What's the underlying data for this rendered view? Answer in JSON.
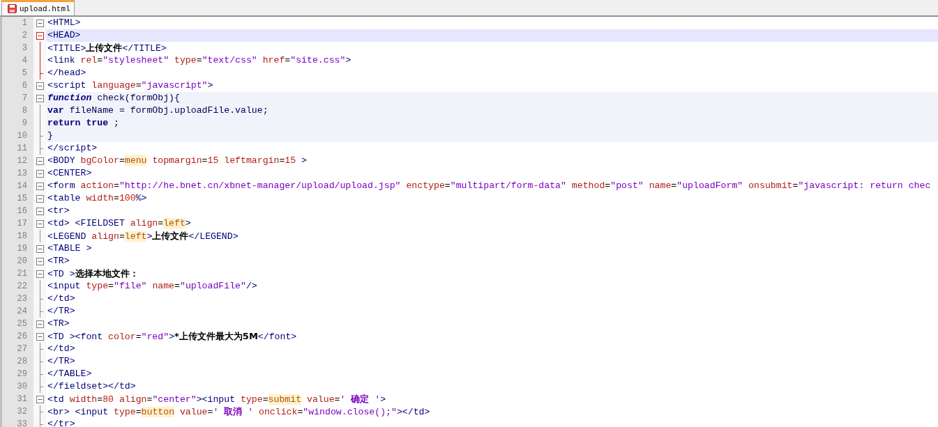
{
  "tab": {
    "label": "upload.html",
    "selected": true
  },
  "lines": [
    {
      "number": "1",
      "kind": "fold-start",
      "fold_active": false,
      "current": false,
      "in_block": false,
      "tokens": [
        {
          "kind": "tag",
          "text": "<HTML>"
        }
      ]
    },
    {
      "number": "2",
      "kind": "fold-start",
      "fold_active": true,
      "current": true,
      "in_block": false,
      "tokens": [
        {
          "kind": "tag",
          "text": "<HEAD>"
        }
      ]
    },
    {
      "number": "3",
      "kind": "fold-body",
      "fold_active": true,
      "current": false,
      "in_block": false,
      "tokens": [
        {
          "kind": "tag",
          "text": "<TITLE>"
        },
        {
          "kind": "text",
          "text": "上传文件"
        },
        {
          "kind": "tag",
          "text": "</TITLE>"
        }
      ]
    },
    {
      "number": "4",
      "kind": "fold-body",
      "fold_active": true,
      "current": false,
      "in_block": false,
      "tokens": [
        {
          "kind": "tag",
          "text": "<link"
        },
        {
          "kind": "attr",
          "text": " rel"
        },
        {
          "kind": "op",
          "text": "="
        },
        {
          "kind": "val",
          "text": "\"stylesheet\""
        },
        {
          "kind": "attr",
          "text": " type"
        },
        {
          "kind": "op",
          "text": "="
        },
        {
          "kind": "val",
          "text": "\"text/css\""
        },
        {
          "kind": "attr",
          "text": " href"
        },
        {
          "kind": "op",
          "text": "="
        },
        {
          "kind": "val",
          "text": "\"site.css\""
        },
        {
          "kind": "tag",
          "text": ">"
        }
      ]
    },
    {
      "number": "5",
      "kind": "fold-end",
      "fold_active": true,
      "current": false,
      "in_block": false,
      "tokens": [
        {
          "kind": "tag",
          "text": "</head>"
        }
      ]
    },
    {
      "number": "6",
      "kind": "fold-start",
      "fold_active": false,
      "current": false,
      "in_block": false,
      "tokens": [
        {
          "kind": "tag",
          "text": "<script"
        },
        {
          "kind": "attr",
          "text": " language"
        },
        {
          "kind": "op",
          "text": "="
        },
        {
          "kind": "val",
          "text": "\"javascript\""
        },
        {
          "kind": "tag",
          "text": ">"
        }
      ]
    },
    {
      "number": "7",
      "kind": "fold-start",
      "fold_active": false,
      "current": false,
      "in_block": true,
      "tokens": [
        {
          "kind": "keyword-italic",
          "text": "function"
        },
        {
          "kind": "js",
          "text": " check(formObj){"
        }
      ]
    },
    {
      "number": "8",
      "kind": "fold-body",
      "fold_active": false,
      "current": false,
      "in_block": true,
      "tokens": [
        {
          "kind": "keyword",
          "text": "var"
        },
        {
          "kind": "js",
          "text": " fileName = formObj.uploadFile.value;"
        }
      ]
    },
    {
      "number": "9",
      "kind": "fold-body",
      "fold_active": false,
      "current": false,
      "in_block": true,
      "tokens": [
        {
          "kind": "keyword",
          "text": "return true"
        },
        {
          "kind": "js",
          "text": " ;"
        }
      ]
    },
    {
      "number": "10",
      "kind": "fold-end",
      "fold_active": false,
      "current": false,
      "in_block": true,
      "tokens": [
        {
          "kind": "js",
          "text": "}"
        }
      ]
    },
    {
      "number": "11",
      "kind": "fold-end",
      "fold_active": false,
      "current": false,
      "in_block": false,
      "tokens": [
        {
          "kind": "tag",
          "text": "</script>"
        }
      ]
    },
    {
      "number": "12",
      "kind": "fold-start",
      "fold_active": false,
      "current": false,
      "in_block": false,
      "tokens": [
        {
          "kind": "tag",
          "text": "<BODY"
        },
        {
          "kind": "attr",
          "text": " bgColor"
        },
        {
          "kind": "op",
          "text": "="
        },
        {
          "kind": "bare",
          "text": "menu"
        },
        {
          "kind": "attr",
          "text": " topmargin"
        },
        {
          "kind": "op",
          "text": "="
        },
        {
          "kind": "num",
          "text": "15"
        },
        {
          "kind": "attr",
          "text": " leftmargin"
        },
        {
          "kind": "op",
          "text": "="
        },
        {
          "kind": "num",
          "text": "15"
        },
        {
          "kind": "tag",
          "text": " >"
        }
      ]
    },
    {
      "number": "13",
      "kind": "fold-start",
      "fold_active": false,
      "current": false,
      "in_block": false,
      "tokens": [
        {
          "kind": "tag",
          "text": "<CENTER>"
        }
      ]
    },
    {
      "number": "14",
      "kind": "fold-start",
      "fold_active": false,
      "current": false,
      "in_block": false,
      "tokens": [
        {
          "kind": "tag",
          "text": "<form"
        },
        {
          "kind": "attr",
          "text": " action"
        },
        {
          "kind": "op",
          "text": "="
        },
        {
          "kind": "val",
          "text": "\"http://he.bnet.cn/xbnet-manager/upload/upload.jsp\""
        },
        {
          "kind": "attr",
          "text": " enctype"
        },
        {
          "kind": "op",
          "text": "="
        },
        {
          "kind": "val",
          "text": "\"multipart/form-data\""
        },
        {
          "kind": "attr",
          "text": " method"
        },
        {
          "kind": "op",
          "text": "="
        },
        {
          "kind": "val",
          "text": "\"post\""
        },
        {
          "kind": "attr",
          "text": " name"
        },
        {
          "kind": "op",
          "text": "="
        },
        {
          "kind": "val",
          "text": "\"uploadForm\""
        },
        {
          "kind": "attr",
          "text": " onsubmit"
        },
        {
          "kind": "op",
          "text": "="
        },
        {
          "kind": "val",
          "text": "\"javascript: return chec"
        }
      ]
    },
    {
      "number": "15",
      "kind": "fold-start",
      "fold_active": false,
      "current": false,
      "in_block": false,
      "tokens": [
        {
          "kind": "tag",
          "text": "<table"
        },
        {
          "kind": "attr",
          "text": " width"
        },
        {
          "kind": "op",
          "text": "="
        },
        {
          "kind": "num",
          "text": "100"
        },
        {
          "kind": "tag",
          "text": "%>"
        }
      ]
    },
    {
      "number": "16",
      "kind": "fold-start",
      "fold_active": false,
      "current": false,
      "in_block": false,
      "tokens": [
        {
          "kind": "tag",
          "text": "<tr>"
        }
      ]
    },
    {
      "number": "17",
      "kind": "fold-start",
      "fold_active": false,
      "current": false,
      "in_block": false,
      "tokens": [
        {
          "kind": "tag",
          "text": "<td> <FIELDSET"
        },
        {
          "kind": "attr",
          "text": " align"
        },
        {
          "kind": "op",
          "text": "="
        },
        {
          "kind": "bare",
          "text": "left"
        },
        {
          "kind": "tag",
          "text": ">"
        }
      ]
    },
    {
      "number": "18",
      "kind": "fold-body",
      "fold_active": false,
      "current": false,
      "in_block": false,
      "tokens": [
        {
          "kind": "tag",
          "text": "<LEGEND"
        },
        {
          "kind": "attr",
          "text": " align"
        },
        {
          "kind": "op",
          "text": "="
        },
        {
          "kind": "bare",
          "text": "left"
        },
        {
          "kind": "tag",
          "text": ">"
        },
        {
          "kind": "text",
          "text": "上传文件"
        },
        {
          "kind": "tag",
          "text": "</LEGEND>"
        }
      ]
    },
    {
      "number": "19",
      "kind": "fold-start",
      "fold_active": false,
      "current": false,
      "in_block": false,
      "tokens": [
        {
          "kind": "tag",
          "text": "<TABLE >"
        }
      ]
    },
    {
      "number": "20",
      "kind": "fold-start",
      "fold_active": false,
      "current": false,
      "in_block": false,
      "tokens": [
        {
          "kind": "tag",
          "text": "<TR>"
        }
      ]
    },
    {
      "number": "21",
      "kind": "fold-start",
      "fold_active": false,
      "current": false,
      "in_block": false,
      "tokens": [
        {
          "kind": "tag",
          "text": "<TD >"
        },
        {
          "kind": "text",
          "text": "选择本地文件："
        }
      ]
    },
    {
      "number": "22",
      "kind": "fold-body",
      "fold_active": false,
      "current": false,
      "in_block": false,
      "tokens": [
        {
          "kind": "tag",
          "text": "<input"
        },
        {
          "kind": "attr",
          "text": " type"
        },
        {
          "kind": "op",
          "text": "="
        },
        {
          "kind": "val",
          "text": "\"file\""
        },
        {
          "kind": "attr",
          "text": " name"
        },
        {
          "kind": "op",
          "text": "="
        },
        {
          "kind": "val",
          "text": "\"uploadFile\""
        },
        {
          "kind": "tag",
          "text": "/>"
        }
      ]
    },
    {
      "number": "23",
      "kind": "fold-end",
      "fold_active": false,
      "current": false,
      "in_block": false,
      "tokens": [
        {
          "kind": "tag",
          "text": "</td>"
        }
      ]
    },
    {
      "number": "24",
      "kind": "fold-end",
      "fold_active": false,
      "current": false,
      "in_block": false,
      "tokens": [
        {
          "kind": "tag",
          "text": "</TR>"
        }
      ]
    },
    {
      "number": "25",
      "kind": "fold-start",
      "fold_active": false,
      "current": false,
      "in_block": false,
      "tokens": [
        {
          "kind": "tag",
          "text": "<TR>"
        }
      ]
    },
    {
      "number": "26",
      "kind": "fold-start",
      "fold_active": false,
      "current": false,
      "in_block": false,
      "tokens": [
        {
          "kind": "tag",
          "text": "<TD ><font"
        },
        {
          "kind": "attr",
          "text": " color"
        },
        {
          "kind": "op",
          "text": "="
        },
        {
          "kind": "val",
          "text": "\"red\""
        },
        {
          "kind": "tag",
          "text": ">"
        },
        {
          "kind": "text",
          "text": "*上传文件最大为5M"
        },
        {
          "kind": "tag",
          "text": "</font>"
        }
      ]
    },
    {
      "number": "27",
      "kind": "fold-end",
      "fold_active": false,
      "current": false,
      "in_block": false,
      "tokens": [
        {
          "kind": "tag",
          "text": "</td>"
        }
      ]
    },
    {
      "number": "28",
      "kind": "fold-end",
      "fold_active": false,
      "current": false,
      "in_block": false,
      "tokens": [
        {
          "kind": "tag",
          "text": "</TR>"
        }
      ]
    },
    {
      "number": "29",
      "kind": "fold-end",
      "fold_active": false,
      "current": false,
      "in_block": false,
      "tokens": [
        {
          "kind": "tag",
          "text": "</TABLE>"
        }
      ]
    },
    {
      "number": "30",
      "kind": "fold-end",
      "fold_active": false,
      "current": false,
      "in_block": false,
      "tokens": [
        {
          "kind": "tag",
          "text": "</fieldset></td>"
        }
      ]
    },
    {
      "number": "31",
      "kind": "fold-start",
      "fold_active": false,
      "current": false,
      "in_block": false,
      "tokens": [
        {
          "kind": "tag",
          "text": "<td"
        },
        {
          "kind": "attr",
          "text": " width"
        },
        {
          "kind": "op",
          "text": "="
        },
        {
          "kind": "num",
          "text": "80"
        },
        {
          "kind": "attr",
          "text": " align"
        },
        {
          "kind": "op",
          "text": "="
        },
        {
          "kind": "val",
          "text": "\"center\""
        },
        {
          "kind": "tag",
          "text": "><input"
        },
        {
          "kind": "attr",
          "text": " type"
        },
        {
          "kind": "op",
          "text": "="
        },
        {
          "kind": "bare",
          "text": "submit"
        },
        {
          "kind": "attr",
          "text": " value"
        },
        {
          "kind": "op",
          "text": "="
        },
        {
          "kind": "val",
          "text": "' "
        },
        {
          "kind": "val-bold",
          "text": "确定"
        },
        {
          "kind": "val",
          "text": " '"
        },
        {
          "kind": "tag",
          "text": ">"
        }
      ]
    },
    {
      "number": "32",
      "kind": "fold-end",
      "fold_active": false,
      "current": false,
      "in_block": false,
      "tokens": [
        {
          "kind": "tag",
          "text": "<br> <input"
        },
        {
          "kind": "attr",
          "text": " type"
        },
        {
          "kind": "op",
          "text": "="
        },
        {
          "kind": "bare",
          "text": "button"
        },
        {
          "kind": "attr",
          "text": " value"
        },
        {
          "kind": "op",
          "text": "="
        },
        {
          "kind": "val",
          "text": "' "
        },
        {
          "kind": "val-bold",
          "text": "取消"
        },
        {
          "kind": "val",
          "text": " '"
        },
        {
          "kind": "attr",
          "text": " onclick"
        },
        {
          "kind": "op",
          "text": "="
        },
        {
          "kind": "val",
          "text": "\"window.close();\""
        },
        {
          "kind": "tag",
          "text": "></td>"
        }
      ]
    },
    {
      "number": "33",
      "kind": "fold-end",
      "fold_active": false,
      "current": false,
      "in_block": false,
      "tokens": [
        {
          "kind": "tag",
          "text": "</tr>"
        }
      ]
    }
  ]
}
